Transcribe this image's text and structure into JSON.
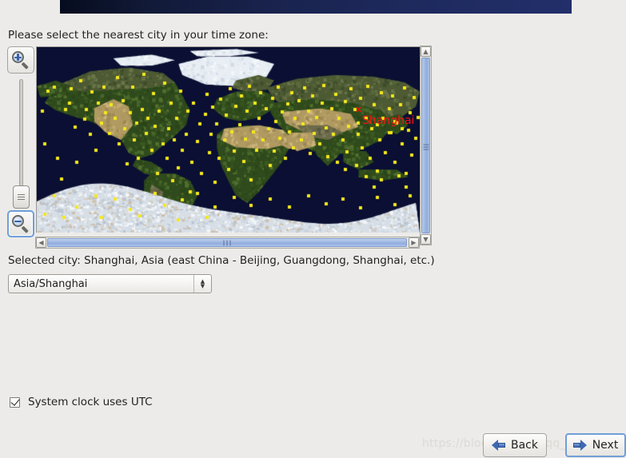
{
  "window": {
    "background_color": "#edebe9",
    "banner_color_start": "#060c1e",
    "banner_color_end": "#222f6a"
  },
  "prompt": {
    "label": "Please select the nearest city in your time zone:"
  },
  "map": {
    "marker_glyph": "x",
    "marker_color": "#ff0000",
    "city_label": "Shanghai",
    "zoom_in_icon": "magnifier-plus-icon",
    "zoom_out_icon": "magnifier-minus-icon",
    "scrollbar_up_glyph": "▲",
    "scrollbar_down_glyph": "▼",
    "scrollbar_left_glyph": "◀",
    "scrollbar_right_glyph": "▶",
    "ocean_color": "#0a0f33",
    "city_dot_color": "#f5e91a"
  },
  "selected_city": {
    "text": "Selected city: Shanghai, Asia (east China - Beijing, Guangdong, Shanghai, etc.)"
  },
  "timezone": {
    "value": "Asia/Shanghai",
    "arrow_up_glyph": "▲",
    "arrow_down_glyph": "▼"
  },
  "utc": {
    "label": "System clock uses UTC",
    "checked": true
  },
  "watermark": {
    "text": "https://blog.csdn.net/qq_44500625"
  },
  "footer": {
    "back_label": "Back",
    "next_label": "Next"
  }
}
